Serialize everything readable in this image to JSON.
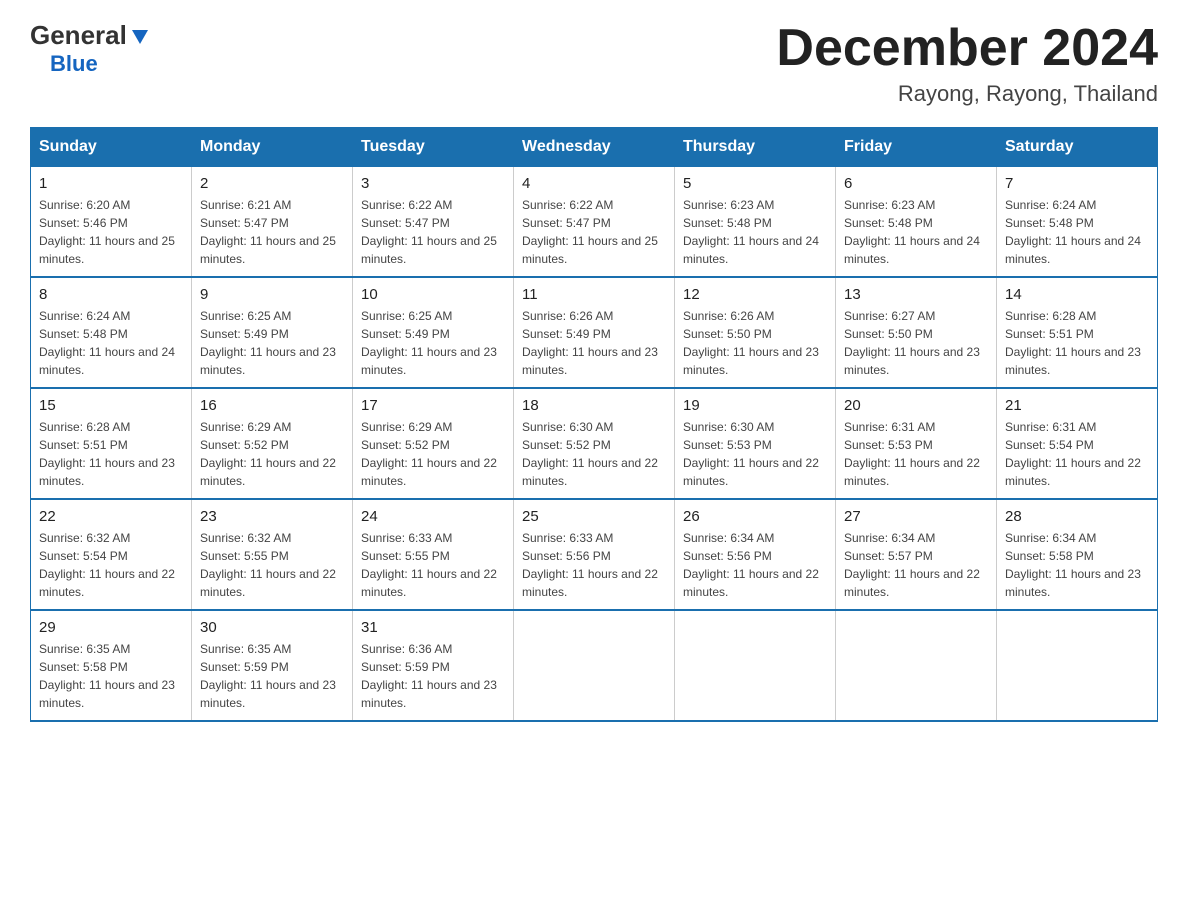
{
  "header": {
    "logo_general": "General",
    "logo_blue": "Blue",
    "month_title": "December 2024",
    "location": "Rayong, Rayong, Thailand"
  },
  "days_of_week": [
    "Sunday",
    "Monday",
    "Tuesday",
    "Wednesday",
    "Thursday",
    "Friday",
    "Saturday"
  ],
  "weeks": [
    [
      {
        "day": "1",
        "sunrise": "6:20 AM",
        "sunset": "5:46 PM",
        "daylight": "11 hours and 25 minutes."
      },
      {
        "day": "2",
        "sunrise": "6:21 AM",
        "sunset": "5:47 PM",
        "daylight": "11 hours and 25 minutes."
      },
      {
        "day": "3",
        "sunrise": "6:22 AM",
        "sunset": "5:47 PM",
        "daylight": "11 hours and 25 minutes."
      },
      {
        "day": "4",
        "sunrise": "6:22 AM",
        "sunset": "5:47 PM",
        "daylight": "11 hours and 25 minutes."
      },
      {
        "day": "5",
        "sunrise": "6:23 AM",
        "sunset": "5:48 PM",
        "daylight": "11 hours and 24 minutes."
      },
      {
        "day": "6",
        "sunrise": "6:23 AM",
        "sunset": "5:48 PM",
        "daylight": "11 hours and 24 minutes."
      },
      {
        "day": "7",
        "sunrise": "6:24 AM",
        "sunset": "5:48 PM",
        "daylight": "11 hours and 24 minutes."
      }
    ],
    [
      {
        "day": "8",
        "sunrise": "6:24 AM",
        "sunset": "5:48 PM",
        "daylight": "11 hours and 24 minutes."
      },
      {
        "day": "9",
        "sunrise": "6:25 AM",
        "sunset": "5:49 PM",
        "daylight": "11 hours and 23 minutes."
      },
      {
        "day": "10",
        "sunrise": "6:25 AM",
        "sunset": "5:49 PM",
        "daylight": "11 hours and 23 minutes."
      },
      {
        "day": "11",
        "sunrise": "6:26 AM",
        "sunset": "5:49 PM",
        "daylight": "11 hours and 23 minutes."
      },
      {
        "day": "12",
        "sunrise": "6:26 AM",
        "sunset": "5:50 PM",
        "daylight": "11 hours and 23 minutes."
      },
      {
        "day": "13",
        "sunrise": "6:27 AM",
        "sunset": "5:50 PM",
        "daylight": "11 hours and 23 minutes."
      },
      {
        "day": "14",
        "sunrise": "6:28 AM",
        "sunset": "5:51 PM",
        "daylight": "11 hours and 23 minutes."
      }
    ],
    [
      {
        "day": "15",
        "sunrise": "6:28 AM",
        "sunset": "5:51 PM",
        "daylight": "11 hours and 23 minutes."
      },
      {
        "day": "16",
        "sunrise": "6:29 AM",
        "sunset": "5:52 PM",
        "daylight": "11 hours and 22 minutes."
      },
      {
        "day": "17",
        "sunrise": "6:29 AM",
        "sunset": "5:52 PM",
        "daylight": "11 hours and 22 minutes."
      },
      {
        "day": "18",
        "sunrise": "6:30 AM",
        "sunset": "5:52 PM",
        "daylight": "11 hours and 22 minutes."
      },
      {
        "day": "19",
        "sunrise": "6:30 AM",
        "sunset": "5:53 PM",
        "daylight": "11 hours and 22 minutes."
      },
      {
        "day": "20",
        "sunrise": "6:31 AM",
        "sunset": "5:53 PM",
        "daylight": "11 hours and 22 minutes."
      },
      {
        "day": "21",
        "sunrise": "6:31 AM",
        "sunset": "5:54 PM",
        "daylight": "11 hours and 22 minutes."
      }
    ],
    [
      {
        "day": "22",
        "sunrise": "6:32 AM",
        "sunset": "5:54 PM",
        "daylight": "11 hours and 22 minutes."
      },
      {
        "day": "23",
        "sunrise": "6:32 AM",
        "sunset": "5:55 PM",
        "daylight": "11 hours and 22 minutes."
      },
      {
        "day": "24",
        "sunrise": "6:33 AM",
        "sunset": "5:55 PM",
        "daylight": "11 hours and 22 minutes."
      },
      {
        "day": "25",
        "sunrise": "6:33 AM",
        "sunset": "5:56 PM",
        "daylight": "11 hours and 22 minutes."
      },
      {
        "day": "26",
        "sunrise": "6:34 AM",
        "sunset": "5:56 PM",
        "daylight": "11 hours and 22 minutes."
      },
      {
        "day": "27",
        "sunrise": "6:34 AM",
        "sunset": "5:57 PM",
        "daylight": "11 hours and 22 minutes."
      },
      {
        "day": "28",
        "sunrise": "6:34 AM",
        "sunset": "5:58 PM",
        "daylight": "11 hours and 23 minutes."
      }
    ],
    [
      {
        "day": "29",
        "sunrise": "6:35 AM",
        "sunset": "5:58 PM",
        "daylight": "11 hours and 23 minutes."
      },
      {
        "day": "30",
        "sunrise": "6:35 AM",
        "sunset": "5:59 PM",
        "daylight": "11 hours and 23 minutes."
      },
      {
        "day": "31",
        "sunrise": "6:36 AM",
        "sunset": "5:59 PM",
        "daylight": "11 hours and 23 minutes."
      },
      null,
      null,
      null,
      null
    ]
  ]
}
